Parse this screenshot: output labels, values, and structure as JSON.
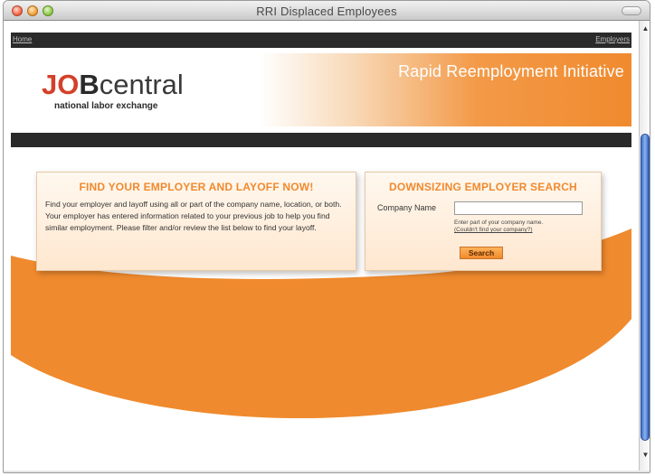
{
  "window": {
    "title": "RRI Displaced Employees"
  },
  "nav": {
    "home": "Home",
    "employers": "Employers"
  },
  "banner": {
    "logo_jo": "JO",
    "logo_b": "B",
    "logo_central": "central",
    "logo_tagline": "national labor exchange",
    "subtitle": "Rapid Reemployment Initiative"
  },
  "left_card": {
    "title": "FIND YOUR EMPLOYER AND LAYOFF NOW!",
    "body": "Find your employer and layoff using all or part of the company name, location, or both. Your employer has entered information related to your previous job to help you find similar employment. Please filter and/or review the list below to find your layoff."
  },
  "right_card": {
    "title": "DOWNSIZING EMPLOYER SEARCH",
    "company_label": "Company Name",
    "company_value": "",
    "hint": "Enter part of your company name.",
    "hint_link": "(Couldn't find your company?)",
    "search_label": "Search"
  },
  "colors": {
    "accent": "#f08a2e",
    "logo_red": "#d4402a",
    "dark": "#2a2a2a"
  },
  "icons": {
    "close": "close-button-icon",
    "minimize": "minimize-button-icon",
    "zoom": "zoom-button-icon"
  }
}
